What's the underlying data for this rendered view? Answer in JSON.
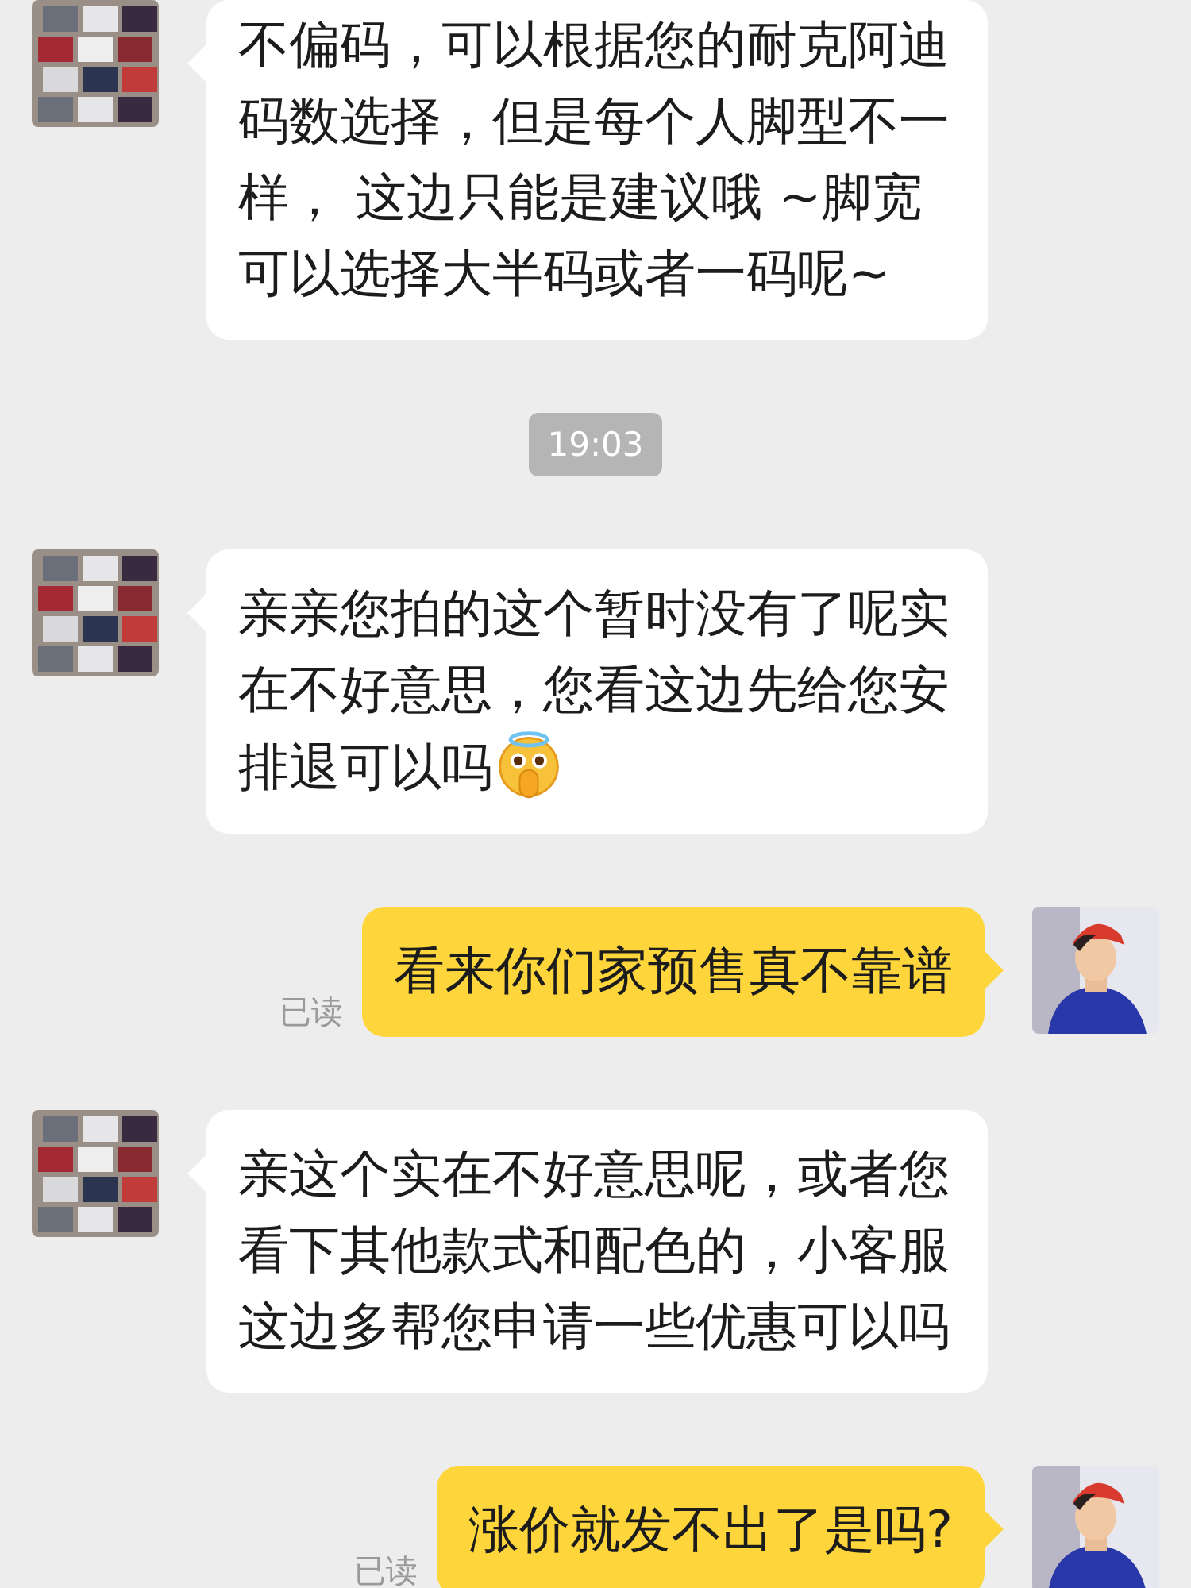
{
  "messages": [
    {
      "kind": "message",
      "outgoing": false,
      "parts": [
        {
          "kind": "text",
          "text": "不偏码，可以根据您的耐克阿迪码数选择，但是每个人脚型不一样， 这边只能是建议哦 ~脚宽可以选择大半码或者一码呢~"
        }
      ]
    },
    {
      "kind": "time",
      "text": "19:03"
    },
    {
      "kind": "message",
      "outgoing": false,
      "parts": [
        {
          "kind": "text",
          "text": "亲亲您拍的这个暂时没有了呢实在不好意思，您看这边先给您安"
        },
        {
          "kind": "text",
          "text": "排退可以吗"
        },
        {
          "kind": "emoji"
        }
      ]
    },
    {
      "kind": "message",
      "outgoing": true,
      "status": "已读",
      "parts": [
        {
          "kind": "text",
          "text": "看来你们家预售真不靠谱"
        }
      ]
    },
    {
      "kind": "message",
      "outgoing": false,
      "parts": [
        {
          "kind": "text",
          "text": "亲这个实在不好意思呢，或者您看下其他款式和配色的，小客服这边多帮您申请一些优惠可以吗"
        }
      ]
    },
    {
      "kind": "message",
      "outgoing": true,
      "status": "已读",
      "parts": [
        {
          "kind": "text",
          "text": "涨价就发不出了是吗?"
        }
      ]
    }
  ]
}
